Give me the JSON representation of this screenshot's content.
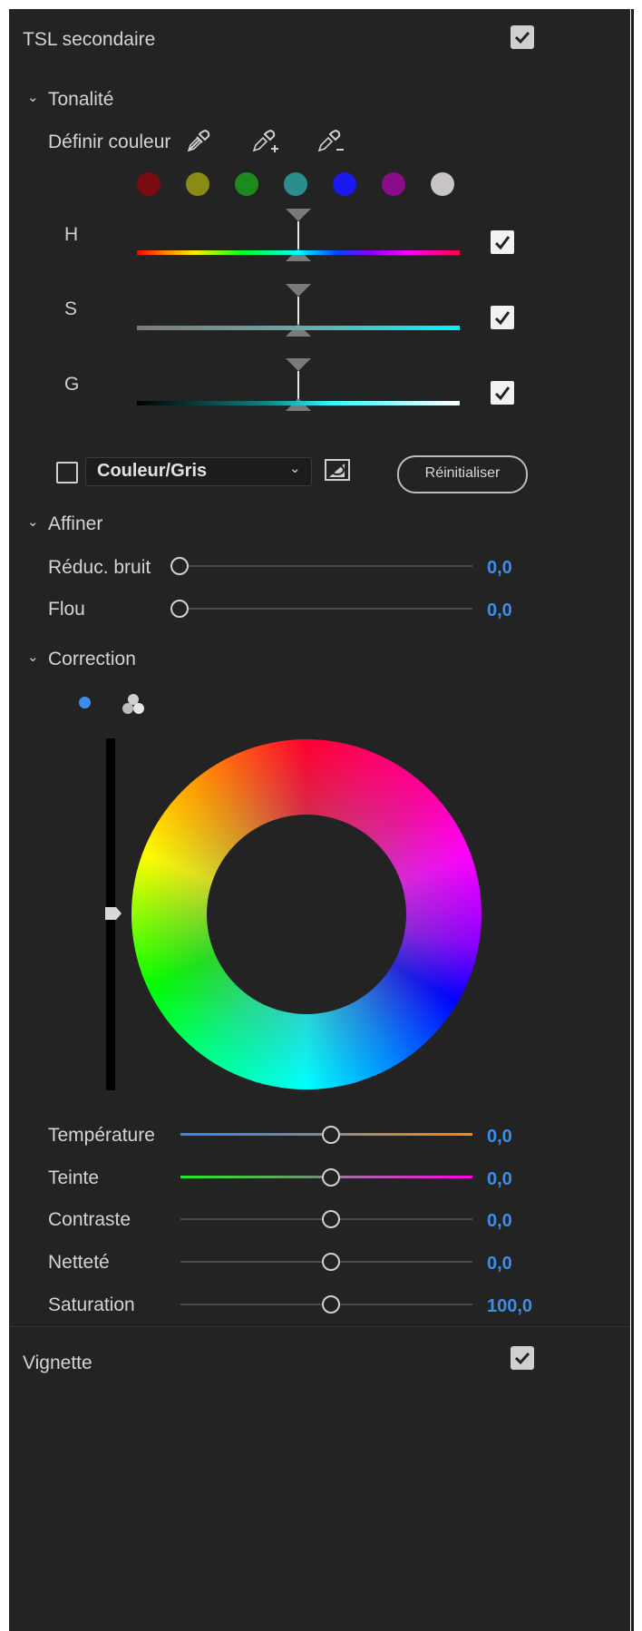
{
  "header": {
    "title": "TSL secondaire",
    "enabled": true
  },
  "tonalite": {
    "section_title": "Tonalité",
    "define_color_label": "Définir couleur",
    "swatches": [
      "#7a0c10",
      "#8a8a16",
      "#1e8a1e",
      "#2b8e8e",
      "#1a1aee",
      "#8a0c8a",
      "#c8c4c8"
    ],
    "channels": [
      {
        "label": "H",
        "checked": true
      },
      {
        "label": "S",
        "checked": true
      },
      {
        "label": "G",
        "checked": true
      }
    ]
  },
  "mask": {
    "show_checked": false,
    "mode": "Couleur/Gris",
    "reset_label": "Réinitialiser"
  },
  "affiner": {
    "section_title": "Affiner",
    "rows": [
      {
        "label": "Réduc. bruit",
        "value": "0,0",
        "level": 0
      },
      {
        "label": "Flou",
        "value": "0,0",
        "level": 0
      }
    ]
  },
  "correction": {
    "section_title": "Correction",
    "rows": [
      {
        "label": "Température",
        "value": "0,0",
        "level": 0.5
      },
      {
        "label": "Teinte",
        "value": "0,0",
        "level": 0.5
      },
      {
        "label": "Contraste",
        "value": "0,0",
        "level": 0.5
      },
      {
        "label": "Netteté",
        "value": "0,0",
        "level": 0.5
      },
      {
        "label": "Saturation",
        "value": "100,0",
        "level": 0.5
      }
    ]
  },
  "vignette": {
    "title": "Vignette",
    "enabled": true
  },
  "colors": {
    "accent": "#3c8ee8",
    "panel": "#232323"
  }
}
